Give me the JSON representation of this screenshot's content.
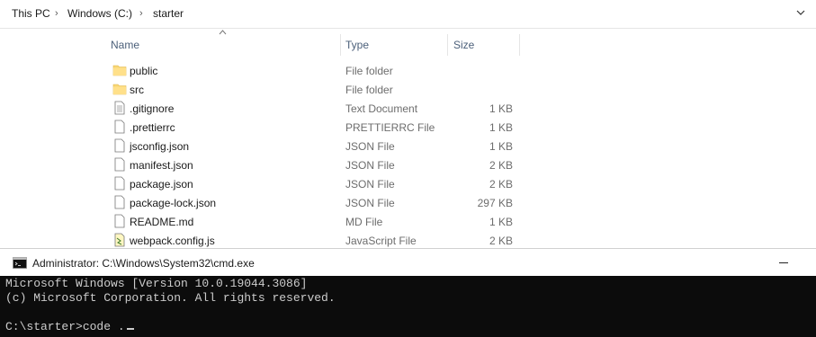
{
  "breadcrumb": {
    "items": [
      "This PC",
      "Windows (C:)",
      "starter"
    ]
  },
  "columns": {
    "name": "Name",
    "type": "Type",
    "size": "Size"
  },
  "files": [
    {
      "name": "public",
      "type": "File folder",
      "size": "",
      "icon": "folder-icon"
    },
    {
      "name": "src",
      "type": "File folder",
      "size": "",
      "icon": "folder-icon"
    },
    {
      "name": ".gitignore",
      "type": "Text Document",
      "size": "1 KB",
      "icon": "text-file-icon"
    },
    {
      "name": ".prettierrc",
      "type": "PRETTIERRC File",
      "size": "1 KB",
      "icon": "file-icon"
    },
    {
      "name": "jsconfig.json",
      "type": "JSON File",
      "size": "1 KB",
      "icon": "file-icon"
    },
    {
      "name": "manifest.json",
      "type": "JSON File",
      "size": "2 KB",
      "icon": "file-icon"
    },
    {
      "name": "package.json",
      "type": "JSON File",
      "size": "2 KB",
      "icon": "file-icon"
    },
    {
      "name": "package-lock.json",
      "type": "JSON File",
      "size": "297 KB",
      "icon": "file-icon"
    },
    {
      "name": "README.md",
      "type": "MD File",
      "size": "1 KB",
      "icon": "file-icon"
    },
    {
      "name": "webpack.config.js",
      "type": "JavaScript File",
      "size": "2 KB",
      "icon": "js-file-icon"
    }
  ],
  "cmd": {
    "title": "Administrator: C:\\Windows\\System32\\cmd.exe",
    "lines": [
      "Microsoft Windows [Version 10.0.19044.3086]",
      "(c) Microsoft Corporation. All rights reserved.",
      "",
      "C:\\starter>code ."
    ]
  }
}
